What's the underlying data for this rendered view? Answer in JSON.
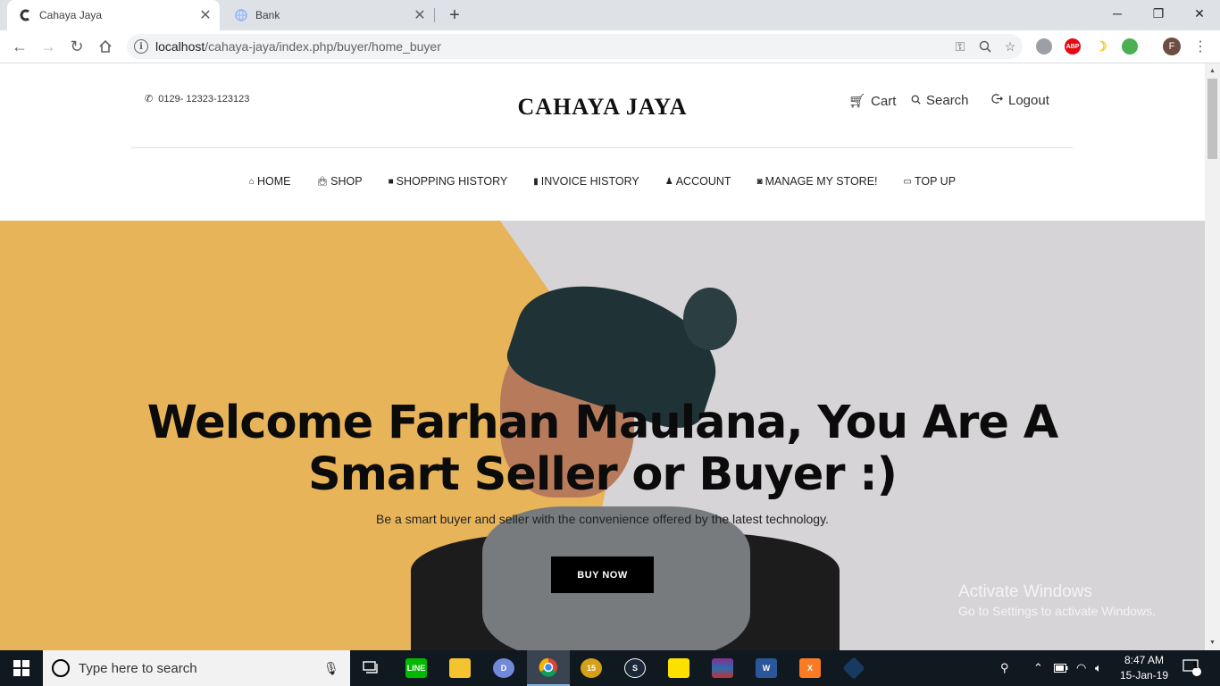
{
  "browser": {
    "tabs": [
      {
        "title": "Cahaya Jaya",
        "active": true
      },
      {
        "title": "Bank",
        "active": false
      }
    ],
    "url_host": "localhost",
    "url_path": "/cahaya-jaya/index.php/buyer/home_buyer",
    "profile_initial": "F",
    "abp_label": "ABP"
  },
  "header": {
    "phone": "0129- 12323-123123",
    "brand": "CAHAYA JAYA",
    "cart": "Cart",
    "search": "Search",
    "logout": "Logout"
  },
  "menu": [
    {
      "label": "HOME",
      "icon": "home-icon"
    },
    {
      "label": "SHOP",
      "icon": "bag-icon"
    },
    {
      "label": "SHOPPING HISTORY",
      "icon": "briefcase-icon"
    },
    {
      "label": "INVOICE HISTORY",
      "icon": "document-icon"
    },
    {
      "label": "ACCOUNT",
      "icon": "user-icon"
    },
    {
      "label": "MANAGE MY STORE!",
      "icon": "camera-icon"
    },
    {
      "label": "TOP UP",
      "icon": "card-icon"
    }
  ],
  "hero": {
    "title_line1": "Welcome Farhan Maulana, You Are A",
    "title_line2": "Smart Seller or Buyer :)",
    "subtitle": "Be a smart buyer and seller with the convenience offered by the latest technology.",
    "button": "BUY NOW"
  },
  "watermark": {
    "line1": "Activate Windows",
    "line2": "Go to Settings to activate Windows."
  },
  "taskbar": {
    "search_placeholder": "Type here to search",
    "time": "8:47 AM",
    "date": "15-Jan-19",
    "notification_count": "1",
    "apps": [
      {
        "name": "LINE",
        "color": "#00b900",
        "glyph": "LINE"
      },
      {
        "name": "File Explorer",
        "color": "#f4c430",
        "glyph": ""
      },
      {
        "name": "Discord",
        "color": "#7289da",
        "glyph": "D"
      },
      {
        "name": "Chrome",
        "color": "#db4437",
        "glyph": ""
      },
      {
        "name": "15",
        "color": "#d4a017",
        "glyph": "15"
      },
      {
        "name": "Steam",
        "color": "#1b2838",
        "glyph": "S"
      },
      {
        "name": "Sticky Notes",
        "color": "#fce100",
        "glyph": ""
      },
      {
        "name": "WinRAR",
        "color": "#8b2c8b",
        "glyph": ""
      },
      {
        "name": "Word",
        "color": "#2b579a",
        "glyph": "W"
      },
      {
        "name": "XAMPP",
        "color": "#fb7a24",
        "glyph": "X"
      },
      {
        "name": "VirtualBox",
        "color": "#183a61",
        "glyph": ""
      }
    ]
  }
}
